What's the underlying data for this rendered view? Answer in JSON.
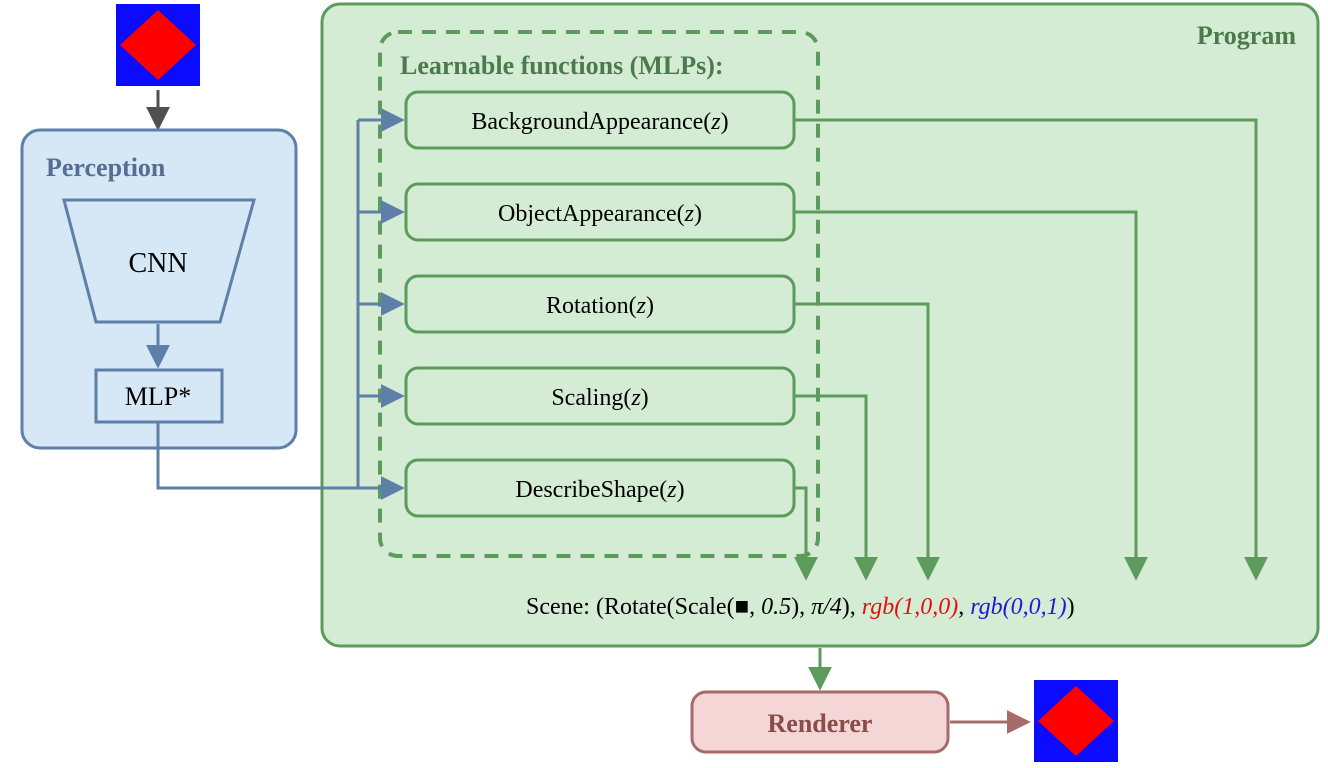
{
  "perception": {
    "title": "Perception",
    "cnn": "CNN",
    "mlp": "MLP*"
  },
  "program": {
    "title": "Program",
    "learnable_title": "Learnable functions (MLPs):",
    "fns": [
      "BackgroundAppearance",
      "ObjectAppearance",
      "Rotation",
      "Scaling",
      "DescribeShape"
    ],
    "z": "z",
    "scene_prefix": "Scene: (Rotate(Scale(",
    "scene_mid1": ", ",
    "scene_scale": "0.5",
    "scene_close1": "), ",
    "scene_angle": "π/4",
    "scene_close2": "), ",
    "scene_rgb1": "rgb(1,0,0)",
    "scene_sep": ", ",
    "scene_rgb2": "rgb(0,0,1)",
    "scene_end": ")"
  },
  "renderer": {
    "title": "Renderer"
  },
  "colors": {
    "perception_fill": "#d6e7f5",
    "perception_stroke": "#5d7fa8",
    "program_fill": "#d3ecd3",
    "program_stroke": "#5d9b5d",
    "renderer_fill": "#f5d6d6",
    "renderer_stroke": "#a86b6b",
    "perception_text": "#556f92",
    "program_text": "#4d7a4d",
    "renderer_text": "#8a4b4b",
    "red": "#e01010",
    "blue": "#1a1ad6",
    "gray": "#505050"
  }
}
